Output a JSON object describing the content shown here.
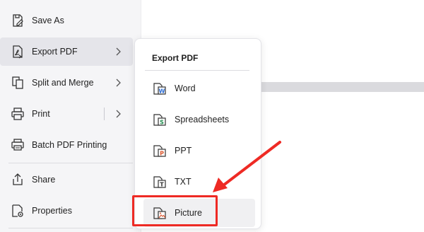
{
  "left_menu": {
    "items": [
      {
        "label": "Save As",
        "icon": "save-as-icon"
      },
      {
        "label": "Export PDF",
        "icon": "export-pdf-icon",
        "has_submenu": true
      },
      {
        "label": "Split and Merge",
        "icon": "split-merge-icon",
        "has_submenu": true
      },
      {
        "label": "Print",
        "icon": "print-icon",
        "has_submenu": true
      },
      {
        "label": "Batch PDF Printing",
        "icon": "batch-print-icon"
      },
      {
        "label": "Share",
        "icon": "share-icon"
      },
      {
        "label": "Properties",
        "icon": "properties-icon"
      }
    ]
  },
  "submenu": {
    "title": "Export PDF",
    "items": [
      {
        "label": "Word",
        "icon": "word-file-icon",
        "badge": "W"
      },
      {
        "label": "Spreadsheets",
        "icon": "spreadsheet-file-icon",
        "badge": "S"
      },
      {
        "label": "PPT",
        "icon": "ppt-file-icon",
        "badge": "P"
      },
      {
        "label": "TXT",
        "icon": "txt-file-icon",
        "badge": "T"
      },
      {
        "label": "Picture",
        "icon": "picture-file-icon"
      }
    ]
  },
  "colors": {
    "annotation_red": "#ee2a24",
    "word_blue": "#2b6cd4",
    "sheet_green": "#1f8a4c",
    "ppt_orange": "#d9542b",
    "menu_bg": "#f5f5f7",
    "active_bg": "#e5e5ea"
  }
}
